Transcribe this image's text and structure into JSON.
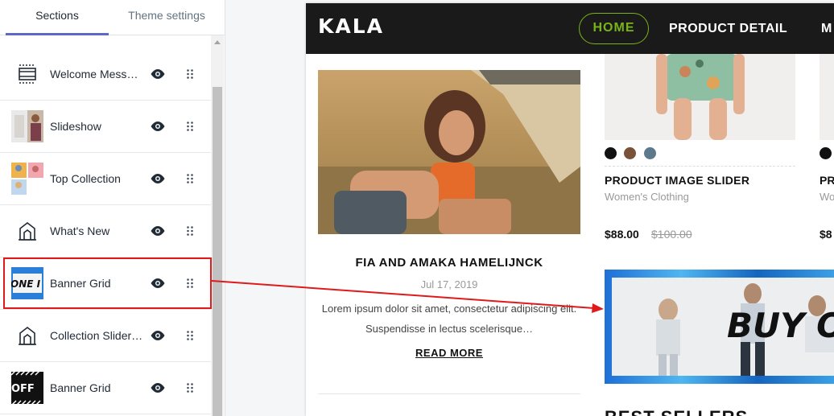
{
  "tabs": {
    "sections": "Sections",
    "theme_settings": "Theme settings"
  },
  "sections": [
    {
      "label": "Welcome Messa…",
      "icon": "layout-icon"
    },
    {
      "label": "Slideshow",
      "icon": "image-thumb"
    },
    {
      "label": "Top Collection",
      "icon": "collection-thumb"
    },
    {
      "label": "What's New",
      "icon": "collection-icon"
    },
    {
      "label": "Banner Grid",
      "icon": "banner-thumb",
      "thumb_text": "ONE I"
    },
    {
      "label": "Collection Slider…",
      "icon": "collection-icon"
    },
    {
      "label": "Banner Grid",
      "icon": "banner-thumb",
      "thumb_text": "OFF"
    }
  ],
  "preview": {
    "logo": "KALA",
    "nav": {
      "home": "HOME",
      "product_detail": "PRODUCT DETAIL",
      "more": "M"
    },
    "blog": {
      "title": "FIA AND AMAKA HAMELIJNCK",
      "date": "Jul 17, 2019",
      "excerpt": "Lorem ipsum dolor sit amet, consectetur adipiscing elit. Suspendisse in lectus scelerisque…",
      "read_more": "READ MORE"
    },
    "product": {
      "name": "PRODUCT IMAGE SLIDER",
      "category": "Women's Clothing",
      "price": "$88.00",
      "old_price": "$100.00",
      "swatches": [
        "#111111",
        "#7a5237",
        "#5d7a8c"
      ]
    },
    "product2": {
      "name": "PR",
      "category": "Wo",
      "price": "$8"
    },
    "banner_text": "BUY O",
    "best_sellers": "BEST SELLERS"
  },
  "colors": {
    "accent_nav": "#7ab317",
    "highlight": "#e01a1a",
    "tab_active": "#5c6ac4"
  }
}
